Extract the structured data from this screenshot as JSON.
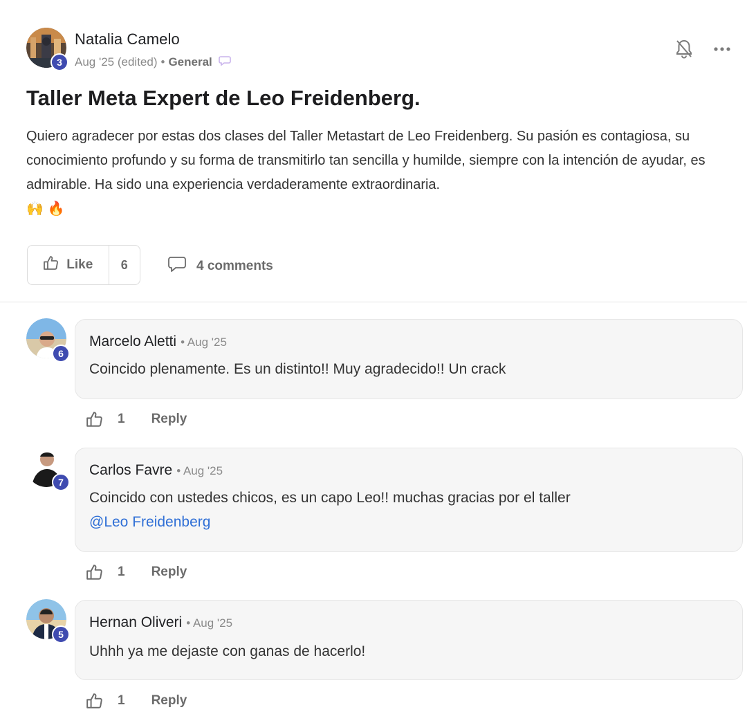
{
  "post": {
    "author": "Natalia Camelo",
    "author_level": "3",
    "date": "Aug '25 (edited)",
    "separator": "•",
    "category": "General",
    "title": "Taller Meta Expert de Leo Freidenberg.",
    "body": "Quiero agradecer por estas dos clases del Taller Metastart de Leo Freidenberg. Su pasión es contagiosa, su conocimiento profundo y su forma de transmitirlo tan sencilla y humilde, siempre con la intención de ayudar, es admirable. Ha sido una experiencia verdaderamente extraordinaria.",
    "emojis": "🙌 🔥",
    "like_label": "Like",
    "like_count": "6",
    "comments_label": "4 comments"
  },
  "icons": {
    "bell": "bell-off-icon",
    "more": "more-horizontal-icon",
    "thumb": "thumbs-up-icon",
    "comment": "comment-icon"
  },
  "colors": {
    "level_badge": "#3f4bb0",
    "mention": "#2f6fd6",
    "bubble_bg": "#f6f6f6"
  },
  "comments": [
    {
      "author": "Marcelo Aletti",
      "date": "• Aug '25",
      "level": "6",
      "text": "Coincido plenamente. Es un distinto!! Muy agradecido!! Un crack",
      "likes": "1",
      "reply_label": "Reply"
    },
    {
      "author": "Carlos Favre",
      "date": "• Aug '25",
      "level": "7",
      "text": "Coincido con ustedes chicos, es un capo Leo!! muchas gracias por el taller",
      "mention": "@Leo Freidenberg",
      "likes": "1",
      "reply_label": "Reply"
    },
    {
      "author": "Hernan Oliveri",
      "date": "• Aug '25",
      "level": "5",
      "text": "Uhhh ya me dejaste con ganas de hacerlo!",
      "likes": "1",
      "reply_label": "Reply"
    }
  ]
}
